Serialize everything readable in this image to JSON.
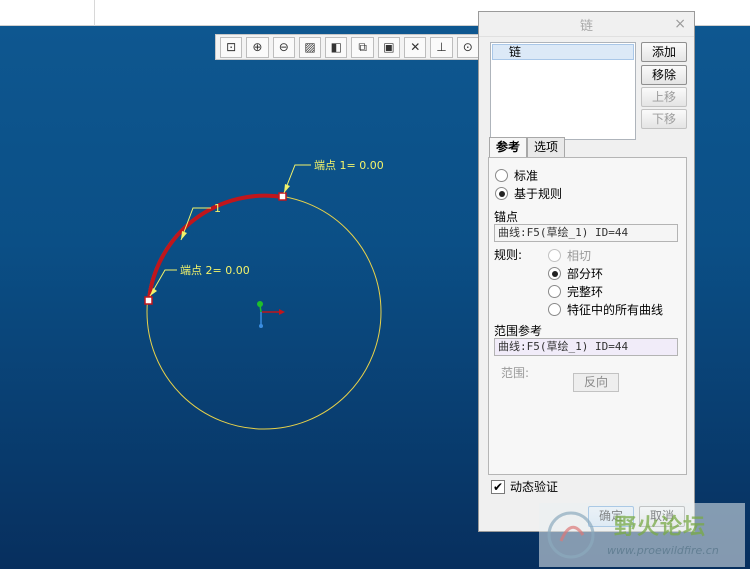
{
  "dialog": {
    "title": "链",
    "close_glyph": "×",
    "list_item": "链",
    "buttons": {
      "add": "添加",
      "remove": "移除",
      "up": "上移",
      "down": "下移"
    },
    "tabs": [
      "参考",
      "选项"
    ],
    "type_options": [
      "标准",
      "基于规则"
    ],
    "selected_type": "基于规则",
    "anchor_label": "锚点",
    "anchor_value": "曲线:F5(草绘_1) ID=44",
    "rule_label": "规则:",
    "rule_options": [
      "相切",
      "部分环",
      "完整环",
      "特征中的所有曲线"
    ],
    "selected_rule": "部分环",
    "range_ref_label": "范围参考",
    "range_ref_value": "曲线:F5(草绘_1) ID=44",
    "range_label": "范围:",
    "reverse_label": "反向",
    "dynamic_verify": "动态验证",
    "dynamic_verify_checked": true,
    "ok": "确定",
    "cancel": "取消"
  },
  "cad": {
    "endpoint1": "端点 1= 0.00",
    "endpoint2": "端点 2= 0.00",
    "chain_number": "1",
    "curve_color": "#e8d24a",
    "chain_color": "#c0161c",
    "label_color": "#f3f36a"
  },
  "toolbar": {
    "icons": [
      "zoom-fit-icon",
      "zoom-in-icon",
      "zoom-out-icon",
      "repaint-icon",
      "display-style-icon",
      "saved-views-icon",
      "view-manager-icon",
      "datum-display-icon",
      "annotation-display-icon",
      "spin-center-icon"
    ]
  },
  "watermark": {
    "text": "野火论坛",
    "url": "www.proewildfire.cn"
  }
}
